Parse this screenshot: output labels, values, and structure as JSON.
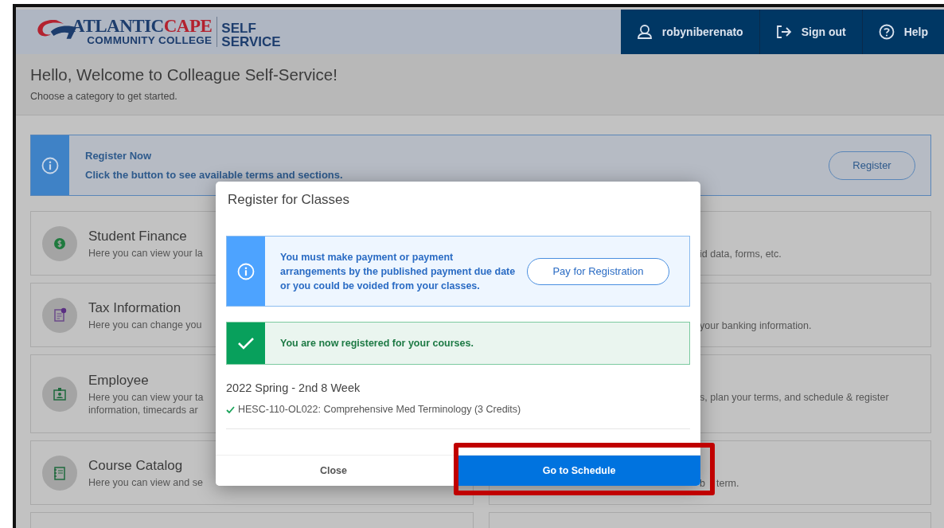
{
  "header": {
    "logo": {
      "word_1": "ATLANTIC",
      "word_2": "CAPE",
      "subtitle": "COMMUNITY COLLEGE",
      "product_1": "SELF",
      "product_2": "SERVICE"
    },
    "nav": [
      {
        "kind": "user",
        "label": "robyniberenato"
      },
      {
        "kind": "signout",
        "label": "Sign out"
      },
      {
        "kind": "help",
        "label": "Help"
      }
    ]
  },
  "welcome": {
    "title": "Hello, Welcome to Colleague Self-Service!",
    "subtitle": "Choose a category to get started."
  },
  "banner": {
    "title": "Register Now",
    "text": "Click the button to see available terms and sections.",
    "button": "Register"
  },
  "categories_left": [
    {
      "kind": "finance",
      "title": "Student Finance",
      "description": [
        "Here you can view your la"
      ]
    },
    {
      "kind": "tax",
      "title": "Tax Information",
      "description": [
        "Here you can change you"
      ]
    },
    {
      "kind": "employee",
      "title": "Employee",
      "description": [
        "Here you can view your ta",
        "information, timecards ar"
      ]
    },
    {
      "kind": "catalog",
      "title": "Course Catalog",
      "description": [
        "Here you can view and se"
      ]
    }
  ],
  "categories_right": [
    {
      "description": [
        "id data, forms, etc."
      ]
    },
    {
      "description": [
        "your banking information."
      ]
    },
    {
      "description": [
        "s, plan your terms, and schedule & register"
      ]
    },
    {
      "description": [
        "b",
        "term."
      ]
    }
  ],
  "modal": {
    "title": "Register for Classes",
    "info_alert": {
      "text": "You must make payment or payment arrangements by the published payment due date or you could be voided from your classes.",
      "button": "Pay for Registration"
    },
    "success_alert": {
      "text": "You are now registered for your courses."
    },
    "term": "2022 Spring - 2nd 8 Week",
    "courses": [
      {
        "text": "HESC-110-OL022: Comprehensive Med Terminology (3 Credits)",
        "registered": true
      }
    ],
    "buttons": [
      {
        "kind": "secondary",
        "label": "Close"
      },
      {
        "kind": "primary",
        "label": "Go to Schedule"
      }
    ]
  }
}
